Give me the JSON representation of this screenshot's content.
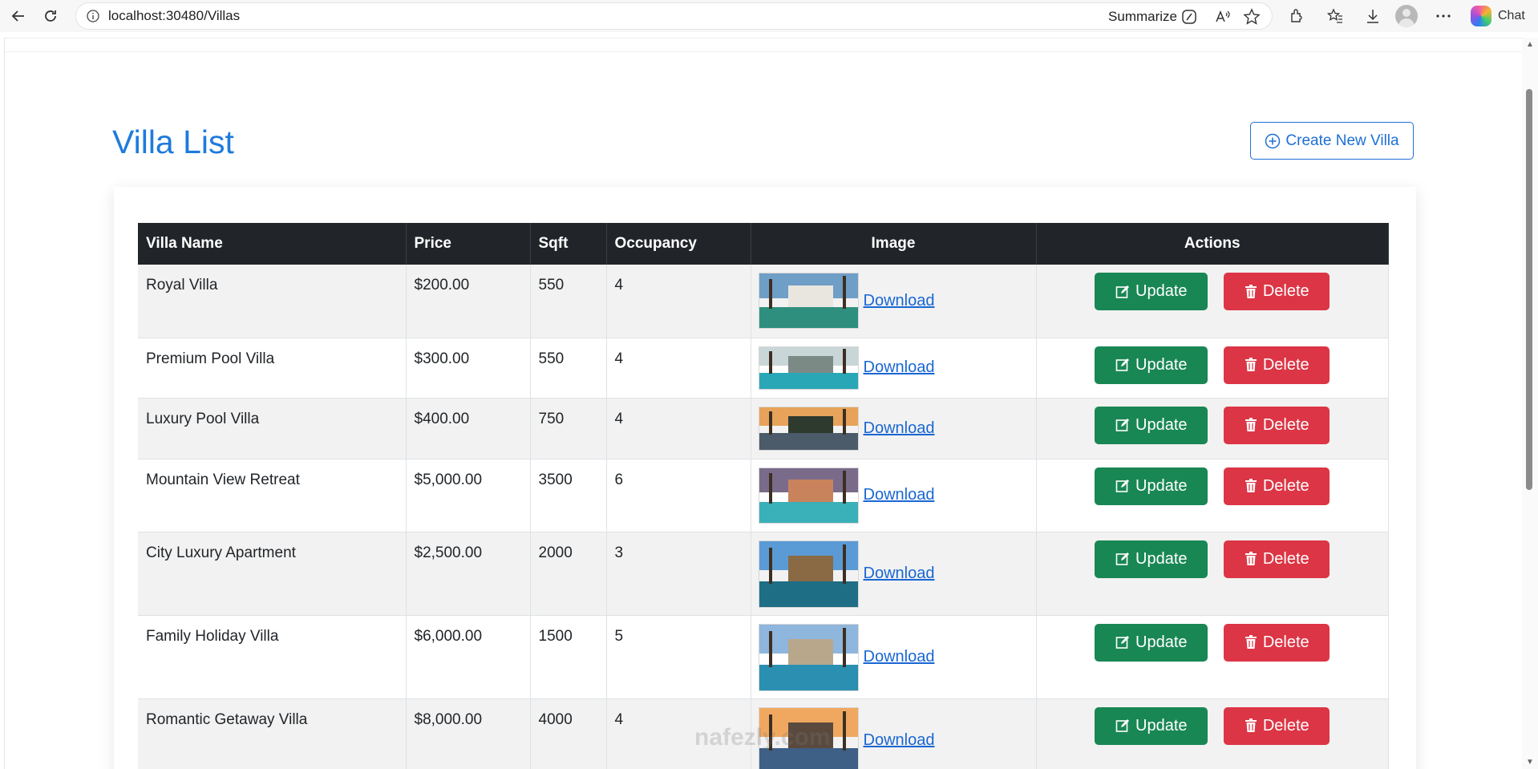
{
  "browser": {
    "url": "localhost:30480/Villas",
    "summarize_label": "Summarize",
    "chat_label": "Chat"
  },
  "page": {
    "title": "Villa List",
    "create_button_label": "Create New Villa"
  },
  "table": {
    "headers": {
      "name": "Villa Name",
      "price": "Price",
      "sqft": "Sqft",
      "occupancy": "Occupancy",
      "image": "Image",
      "actions": "Actions"
    },
    "rows": [
      {
        "name": "Royal Villa",
        "price": "$200.00",
        "sqft": "550",
        "occupancy": "4",
        "download": "Download",
        "update": "Update",
        "delete": "Delete"
      },
      {
        "name": "Premium Pool Villa",
        "price": "$300.00",
        "sqft": "550",
        "occupancy": "4",
        "download": "Download",
        "update": "Update",
        "delete": "Delete"
      },
      {
        "name": "Luxury Pool Villa",
        "price": "$400.00",
        "sqft": "750",
        "occupancy": "4",
        "download": "Download",
        "update": "Update",
        "delete": "Delete"
      },
      {
        "name": "Mountain View Retreat",
        "price": "$5,000.00",
        "sqft": "3500",
        "occupancy": "6",
        "download": "Download",
        "update": "Update",
        "delete": "Delete"
      },
      {
        "name": "City Luxury Apartment",
        "price": "$2,500.00",
        "sqft": "2000",
        "occupancy": "3",
        "download": "Download",
        "update": "Update",
        "delete": "Delete"
      },
      {
        "name": "Family Holiday Villa",
        "price": "$6,000.00",
        "sqft": "1500",
        "occupancy": "5",
        "download": "Download",
        "update": "Update",
        "delete": "Delete"
      },
      {
        "name": "Romantic Getaway Villa",
        "price": "$8,000.00",
        "sqft": "4000",
        "occupancy": "4",
        "download": "Download",
        "update": "Update",
        "delete": "Delete"
      }
    ]
  },
  "watermark": "nafezly.com",
  "colors": {
    "title_blue": "#1e7bdc",
    "header_dark": "#212529",
    "update_green": "#198754",
    "delete_red": "#dc3545",
    "link_blue": "#1967d2"
  }
}
